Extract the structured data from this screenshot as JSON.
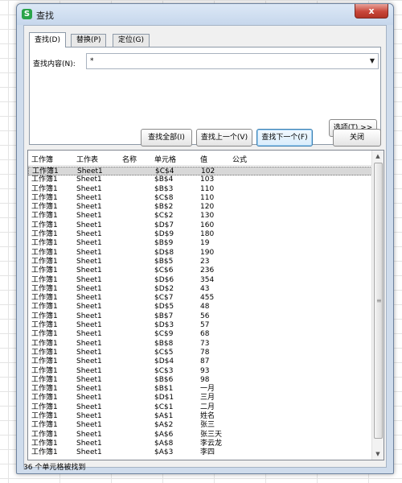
{
  "window": {
    "title": "查找",
    "app_icon": "S",
    "close_glyph": "x"
  },
  "tabs": [
    {
      "label": "查找(D)",
      "active": true
    },
    {
      "label": "替换(P)",
      "active": false
    },
    {
      "label": "定位(G)",
      "active": false
    }
  ],
  "find": {
    "label": "查找内容(N):",
    "value": "*"
  },
  "buttons": {
    "options": "选项(T) >>",
    "find_all": "查找全部(I)",
    "find_prev": "查找上一个(V)",
    "find_next": "查找下一个(F)",
    "close": "关闭"
  },
  "results": {
    "columns": [
      "工作簿",
      "工作表",
      "名称",
      "单元格",
      "值",
      "公式"
    ],
    "rows": [
      [
        "工作簿1",
        "Sheet1",
        "",
        "$C$4",
        "102"
      ],
      [
        "工作簿1",
        "Sheet1",
        "",
        "$B$4",
        "103"
      ],
      [
        "工作簿1",
        "Sheet1",
        "",
        "$B$3",
        "110"
      ],
      [
        "工作簿1",
        "Sheet1",
        "",
        "$C$8",
        "110"
      ],
      [
        "工作簿1",
        "Sheet1",
        "",
        "$B$2",
        "120"
      ],
      [
        "工作簿1",
        "Sheet1",
        "",
        "$C$2",
        "130"
      ],
      [
        "工作簿1",
        "Sheet1",
        "",
        "$D$7",
        "160"
      ],
      [
        "工作簿1",
        "Sheet1",
        "",
        "$D$9",
        "180"
      ],
      [
        "工作簿1",
        "Sheet1",
        "",
        "$B$9",
        "19"
      ],
      [
        "工作簿1",
        "Sheet1",
        "",
        "$D$8",
        "190"
      ],
      [
        "工作簿1",
        "Sheet1",
        "",
        "$B$5",
        "23"
      ],
      [
        "工作簿1",
        "Sheet1",
        "",
        "$C$6",
        "236"
      ],
      [
        "工作簿1",
        "Sheet1",
        "",
        "$D$6",
        "354"
      ],
      [
        "工作簿1",
        "Sheet1",
        "",
        "$D$2",
        "43"
      ],
      [
        "工作簿1",
        "Sheet1",
        "",
        "$C$7",
        "455"
      ],
      [
        "工作簿1",
        "Sheet1",
        "",
        "$D$5",
        "48"
      ],
      [
        "工作簿1",
        "Sheet1",
        "",
        "$B$7",
        "56"
      ],
      [
        "工作簿1",
        "Sheet1",
        "",
        "$D$3",
        "57"
      ],
      [
        "工作簿1",
        "Sheet1",
        "",
        "$C$9",
        "68"
      ],
      [
        "工作簿1",
        "Sheet1",
        "",
        "$B$8",
        "73"
      ],
      [
        "工作簿1",
        "Sheet1",
        "",
        "$C$5",
        "78"
      ],
      [
        "工作簿1",
        "Sheet1",
        "",
        "$D$4",
        "87"
      ],
      [
        "工作簿1",
        "Sheet1",
        "",
        "$C$3",
        "93"
      ],
      [
        "工作簿1",
        "Sheet1",
        "",
        "$B$6",
        "98"
      ],
      [
        "工作簿1",
        "Sheet1",
        "",
        "$B$1",
        "一月"
      ],
      [
        "工作簿1",
        "Sheet1",
        "",
        "$D$1",
        "三月"
      ],
      [
        "工作簿1",
        "Sheet1",
        "",
        "$C$1",
        "二月"
      ],
      [
        "工作簿1",
        "Sheet1",
        "",
        "$A$1",
        "姓名"
      ],
      [
        "工作簿1",
        "Sheet1",
        "",
        "$A$2",
        "张三"
      ],
      [
        "工作簿1",
        "Sheet1",
        "",
        "$A$6",
        "张三天"
      ],
      [
        "工作簿1",
        "Sheet1",
        "",
        "$A$8",
        "李云龙"
      ],
      [
        "工作簿1",
        "Sheet1",
        "",
        "$A$3",
        "李四"
      ]
    ]
  },
  "status": "36 个单元格被找到",
  "colors": {
    "dialog_bg": "#cfdcec",
    "close_red": "#c8473a",
    "selected_row": "#d8d8d8",
    "default_button_border": "#3c7fb1"
  }
}
